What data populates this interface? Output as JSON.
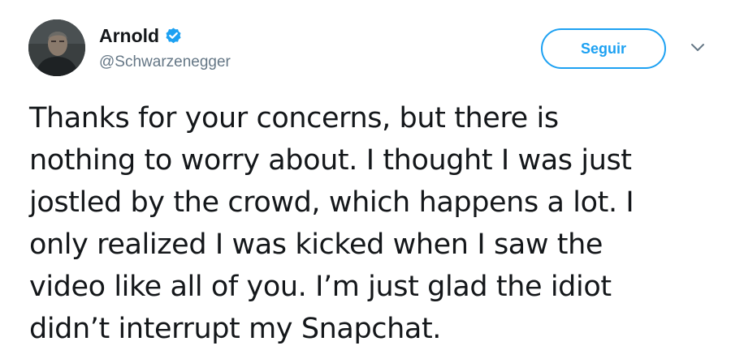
{
  "author": {
    "name": "Arnold",
    "handle": "@Schwarzenegger",
    "verified": true,
    "avatar_icon": "user-avatar"
  },
  "actions": {
    "follow_label": "Seguir",
    "more_icon": "chevron-down-icon"
  },
  "tweet": {
    "lines": [
      "Thanks for your concerns, but there is",
      "nothing to worry about. I thought I was just",
      "jostled by the crowd, which happens a lot. I",
      "only realized I was kicked when I saw the",
      "video like all of you. I’m just glad the idiot",
      "didn’t interrupt my Snapchat."
    ]
  },
  "colors": {
    "accent": "#1da1f2",
    "text": "#14171a",
    "secondary_text": "#657786"
  }
}
